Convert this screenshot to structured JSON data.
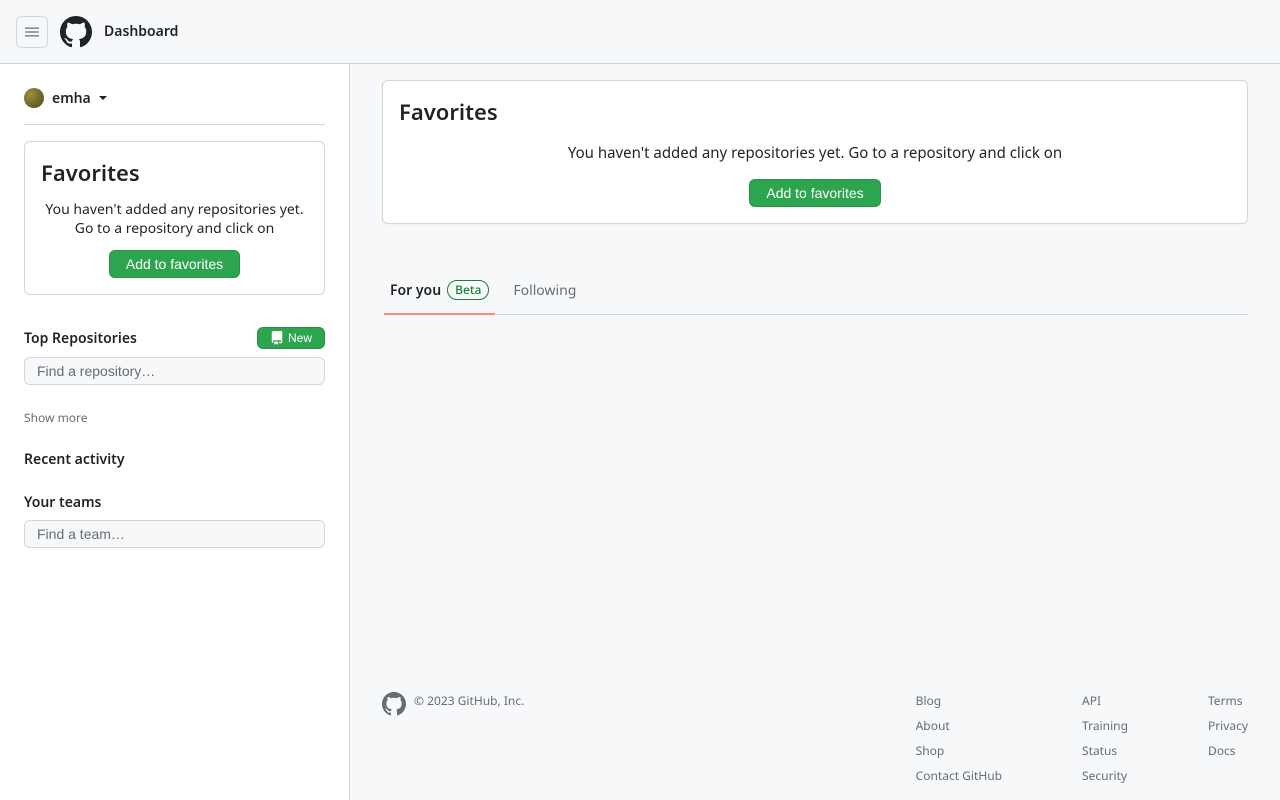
{
  "header": {
    "title": "Dashboard"
  },
  "sidebar": {
    "user": "emha",
    "favorites": {
      "title": "Favorites",
      "message": "You haven't added any repositories yet. Go to a repository and click on",
      "button": "Add to favorites"
    },
    "top_repos": {
      "title": "Top Repositories",
      "new_button": "New",
      "search_placeholder": "Find a repository…"
    },
    "show_more": "Show more",
    "recent_activity_title": "Recent activity",
    "your_teams": {
      "title": "Your teams",
      "search_placeholder": "Find a team…"
    }
  },
  "main": {
    "favorites": {
      "title": "Favorites",
      "message": "You haven't added any repositories yet. Go to a repository and click on",
      "button": "Add to favorites"
    },
    "tabs": {
      "for_you": "For you",
      "beta": "Beta",
      "following": "Following"
    }
  },
  "footer": {
    "copyright": "© 2023 GitHub, Inc.",
    "col1": [
      "Blog",
      "About",
      "Shop",
      "Contact GitHub"
    ],
    "col2": [
      "API",
      "Training",
      "Status",
      "Security"
    ],
    "col3": [
      "Terms",
      "Privacy",
      "Docs"
    ]
  }
}
